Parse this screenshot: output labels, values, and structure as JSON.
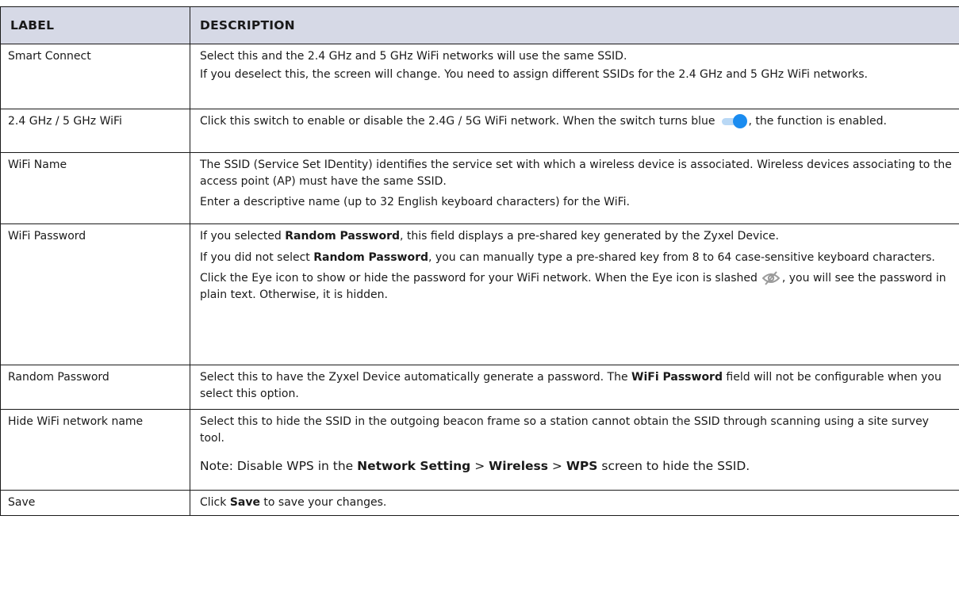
{
  "header": {
    "label": "LABEL",
    "description": "DESCRIPTION"
  },
  "rows": {
    "smart_connect": {
      "label": "Smart Connect",
      "p1": "Select this and the 2.4 GHz and 5 GHz WiFi networks will use the same SSID.",
      "p2": "If you deselect this, the screen will change. You need to assign different SSIDs for the 2.4 GHz and 5 GHz WiFi networks."
    },
    "wifi_switch": {
      "label": "2.4 GHz / 5 GHz WiFi",
      "p1_before": "Click this switch to enable or disable the 2.4G / 5G WiFi network. When the switch turns blue",
      "p1_after": ", the function is enabled.",
      "icon": "toggle-switch-on-icon",
      "icon_color": "#1a8cf0"
    },
    "wifi_name": {
      "label": "WiFi Name",
      "p1": "The SSID (Service Set IDentity) identifies the service set with which a wireless device is associated. Wireless devices associating to the access point (AP) must have the same SSID.",
      "p2": "Enter a descriptive name (up to 32 English keyboard characters) for the WiFi."
    },
    "wifi_password": {
      "label": "WiFi Password",
      "p1_before": "If you selected ",
      "p1_bold": "Random Password",
      "p1_after": ", this field displays a pre-shared key generated by the Zyxel Device.",
      "p2_before": "If you did not select ",
      "p2_bold": "Random Password",
      "p2_after": ", you can manually type a pre-shared key from 8 to 64 case-sensitive keyboard characters.",
      "p3_before": "Click the Eye icon to show or hide the password for your WiFi network. When the Eye icon is slashed",
      "p3_after": ", you will see the password in plain text. Otherwise, it is hidden.",
      "icon": "eye-slashed-icon"
    },
    "random_password": {
      "label": "Random Password",
      "p1_before": "Select this to have the Zyxel Device automatically generate a password. The ",
      "p1_bold": "WiFi Password",
      "p1_after": " field will not be configurable when you select this option."
    },
    "hide_name": {
      "label": "Hide WiFi network name",
      "p1": "Select this to hide the SSID in the outgoing beacon frame so a station cannot obtain the SSID through scanning using a site survey tool.",
      "note_before": "Note: Disable WPS in the ",
      "note_b1": "Network Setting",
      "note_sep1": " > ",
      "note_b2": "Wireless",
      "note_sep2": " > ",
      "note_b3": "WPS",
      "note_after": " screen to hide the SSID."
    },
    "save": {
      "label": "Save",
      "p1_before": "Click ",
      "p1_bold": "Save",
      "p1_after": " to save your changes."
    }
  }
}
